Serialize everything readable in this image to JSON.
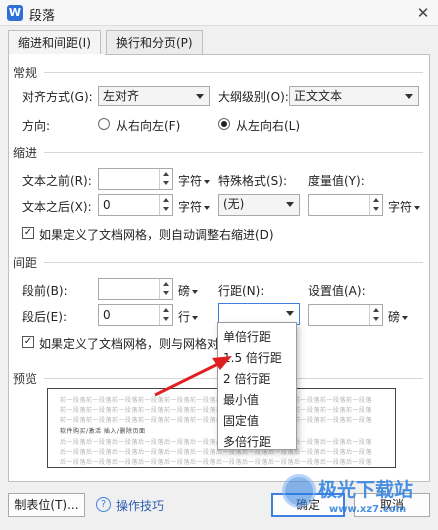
{
  "window": {
    "title": "段落",
    "close": "✕",
    "app_icon": "W"
  },
  "tabs": [
    {
      "label": "缩进和间距(I)",
      "active": true
    },
    {
      "label": "换行和分页(P)",
      "active": false
    }
  ],
  "general": {
    "section": "常规",
    "align_label": "对齐方式(G):",
    "align_value": "左对齐",
    "outline_label": "大纲级别(O):",
    "outline_value": "正文文本",
    "direction_label": "方向:",
    "rtl_label": "从右向左(F)",
    "ltr_label": "从左向右(L)",
    "selected": "ltr"
  },
  "indent": {
    "section": "缩进",
    "before_label": "文本之前(R):",
    "before_value": "",
    "before_unit": "字符",
    "after_label": "文本之后(X):",
    "after_value": "0",
    "after_unit": "字符",
    "special_label": "特殊格式(S):",
    "special_value": "(无)",
    "measure_label": "度量值(Y):",
    "measure_value": "",
    "measure_unit": "字符",
    "auto_check": "如果定义了文档网格，则自动调整右缩进(D)",
    "auto_checked": true
  },
  "spacing": {
    "section": "间距",
    "before_label": "段前(B):",
    "before_value": "",
    "before_unit": "磅",
    "after_label": "段后(E):",
    "after_value": "0",
    "after_unit": "行",
    "line_label": "行距(N):",
    "line_value": "",
    "setting_label": "设置值(A):",
    "setting_value": "",
    "setting_unit": "磅",
    "grid_check": "如果定义了文档网格，则与网格对",
    "grid_checked": true
  },
  "line_spacing_options": [
    "单倍行距",
    "1.5 倍行距",
    "2 倍行距",
    "最小值",
    "固定值",
    "多倍行距"
  ],
  "preview": {
    "section": "预览",
    "prev_text": "前一段落前一段落前一段落前一段落前一段落前一段落前一段落前一段落前一段落前一段落前一段落前一段落",
    "main_text": "软件购买/激活 插入/删除页面",
    "next_text": "后一段落后一段落后一段落后一段落后一段落后一段落后一段落后一段落后一段落后一段落后一段落后一段落"
  },
  "footer": {
    "tabs_button": "制表位(T)...",
    "tips_link": "操作技巧",
    "ok": "确定",
    "cancel": "取消"
  },
  "watermark": {
    "brand": "极光下载站",
    "url": "www.xz7.com"
  },
  "colors": {
    "accent": "#3f7fe0",
    "annotation_arrow": "#e02020"
  }
}
